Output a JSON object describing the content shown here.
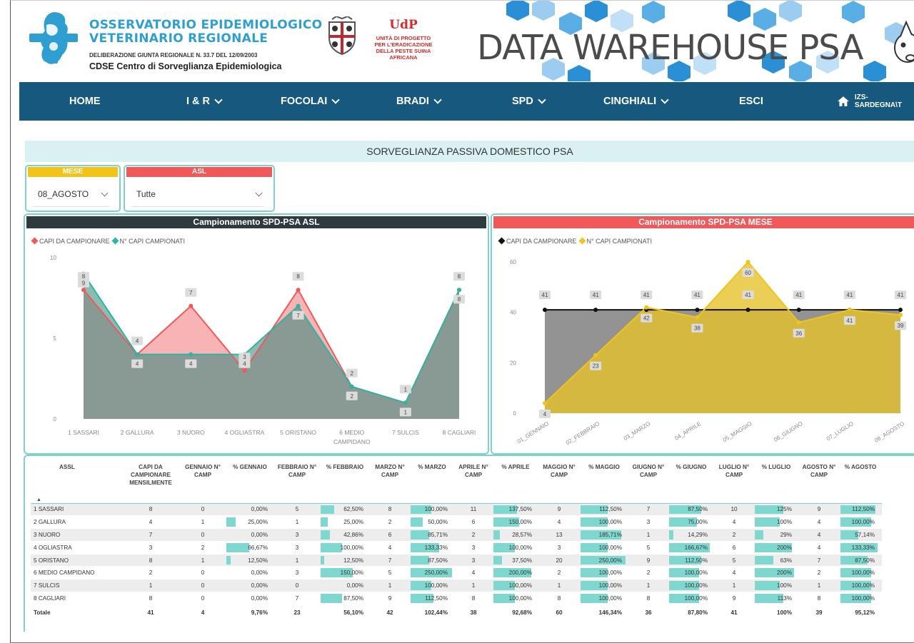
{
  "header": {
    "org_title_1": "OSSERVATORIO EPIDEMIOLOGICO",
    "org_title_2": "VETERINARIO REGIONALE",
    "org_sub": "DELIBERAZIONE GIUNTA REGIONALE N. 33.7 DEL 12/09/2003",
    "org_sub2": "CDSE Centro di Sorveglianza Epidemiologica",
    "udp_title": "UdP",
    "udp_sub": [
      "UNITÀ DI PROGETTO",
      "PER L'ERADICAZIONE",
      "DELLA PESTE SUINA",
      "AFRICANA"
    ],
    "banner_title": "DATA WAREHOUSE PSA",
    "colors": {
      "brand_blue": "#2f9fd2",
      "udp_red": "#d42a2a",
      "hex_blue": "#2b8fd6"
    }
  },
  "nav": {
    "items": [
      {
        "label": "HOME",
        "dropdown": false
      },
      {
        "label": "I & R",
        "dropdown": true
      },
      {
        "label": "FOCOLAI",
        "dropdown": true
      },
      {
        "label": "BRADI",
        "dropdown": true
      },
      {
        "label": "SPD",
        "dropdown": true
      },
      {
        "label": "CINGHIALI",
        "dropdown": true
      },
      {
        "label": "ESCI",
        "dropdown": false
      }
    ],
    "user": "IZS-SARDEGNA\\T",
    "user_icon": "home-icon",
    "background": "#17587e"
  },
  "section_title": "SORVEGLIANZA PASSIVA DOMESTICO PSA",
  "filters": {
    "mese": {
      "label": "MESE",
      "value": "08_AGOSTO",
      "color": "#f0c419"
    },
    "asl": {
      "label": "ASL",
      "value": "Tutte",
      "color": "#f0585a"
    }
  },
  "chart_data": [
    {
      "type": "area",
      "title": "Campionamento SPD-PSA ASL",
      "header_color": "#2f3a3e",
      "legend": [
        "CAPI DA CAMPIONARE",
        "N° CAPI CAMPIONATI"
      ],
      "categories": [
        "1 SASSARI",
        "2 GALLURA",
        "3 NUORO",
        "4 OGLIASTRA",
        "5 ORISTANO",
        "6 MEDIO CAMPIDANO",
        "7 SULCIS",
        "8 CAGLIARI"
      ],
      "series": [
        {
          "name": "CAPI DA CAMPIONARE",
          "values": [
            8,
            4,
            7,
            3,
            8,
            2,
            1,
            8
          ],
          "color": "#f0585a"
        },
        {
          "name": "N° CAPI CAMPIONATI",
          "values": [
            9,
            4,
            4,
            4,
            7,
            2,
            1,
            8
          ],
          "color": "#2bb5a5"
        }
      ],
      "yticks": [
        "0",
        "5",
        "10"
      ],
      "ylim": [
        0,
        10
      ],
      "grid": false
    },
    {
      "type": "area",
      "title": "Campionamento SPD-PSA MESE",
      "header_color": "#f0585a",
      "legend": [
        "CAPI DA CAMPIONARE",
        "N° CAPI CAMPIONATI"
      ],
      "categories": [
        "01_GENNAIO",
        "02_FEBBRAIO",
        "03_MARZO",
        "04_APRILE",
        "05_MAGGIO",
        "06_GIUGNO",
        "07_LUGLIO",
        "08_AGOSTO"
      ],
      "series": [
        {
          "name": "CAPI DA CAMPIONARE",
          "values": [
            41,
            41,
            41,
            41,
            41,
            41,
            41,
            41
          ],
          "color": "#111111"
        },
        {
          "name": "N° CAPI CAMPIONATI",
          "values": [
            4,
            23,
            42,
            38,
            60,
            36,
            41,
            39
          ],
          "color": "#f0c419"
        }
      ],
      "yticks": [
        "0",
        "20",
        "40",
        "60"
      ],
      "ylim": [
        0,
        60
      ],
      "grid": false
    }
  ],
  "table": {
    "headers": [
      "ASSL",
      "CAPI DA CAMPIONARE MENSILMENTE",
      "GENNAIO N° CAMP",
      "% GENNAIO",
      "FEBBRAIO N° CAMP",
      "% FEBBRAIO",
      "MARZO N° CAMP",
      "% MARZO",
      "APRILE N° CAMP",
      "% APRILE",
      "MAGGIO N° CAMP",
      "% MAGGIO",
      "GIUGNO N° CAMP",
      "% GIUGNO",
      "LUGLIO N° CAMP",
      "% LUGLIO",
      "AGOSTO N° CAMP",
      "% AGOSTO"
    ],
    "rows": [
      {
        "name": "1 SASSARI",
        "capi": "8",
        "cells": [
          [
            "0",
            "0,00%",
            0
          ],
          [
            "5",
            "62,50%",
            0.3
          ],
          [
            "8",
            "100,00%",
            0.5
          ],
          [
            "11",
            "137,50%",
            0.55
          ],
          [
            "9",
            "112,50%",
            0.6
          ],
          [
            "7",
            "87,50%",
            0.75
          ],
          [
            "10",
            "125%",
            0.7
          ],
          [
            "9",
            "112,50%",
            0.9
          ]
        ]
      },
      {
        "name": "2 GALLURA",
        "capi": "4",
        "cells": [
          [
            "1",
            "25,00%",
            0.2
          ],
          [
            "1",
            "25,00%",
            0.15
          ],
          [
            "2",
            "50,00%",
            0.3
          ],
          [
            "6",
            "150,00%",
            0.6
          ],
          [
            "4",
            "100,00%",
            0.6
          ],
          [
            "3",
            "75,00%",
            0.65
          ],
          [
            "4",
            "100%",
            0.6
          ],
          [
            "4",
            "100,00%",
            0.8
          ]
        ]
      },
      {
        "name": "3 NUORO",
        "capi": "7",
        "cells": [
          [
            "0",
            "0,00%",
            0
          ],
          [
            "3",
            "42,86%",
            0.2
          ],
          [
            "6",
            "85,71%",
            0.45
          ],
          [
            "2",
            "28,57%",
            0.15
          ],
          [
            "13",
            "185,71%",
            0.9
          ],
          [
            "1",
            "14,29%",
            0.1
          ],
          [
            "2",
            "29%",
            0.2
          ],
          [
            "4",
            "57,14%",
            0.45
          ]
        ]
      },
      {
        "name": "4 OGLIASTRA",
        "capi": "3",
        "cells": [
          [
            "2",
            "66,67%",
            0.5
          ],
          [
            "3",
            "100,00%",
            0.45
          ],
          [
            "4",
            "133,33%",
            0.7
          ],
          [
            "3",
            "100,00%",
            0.5
          ],
          [
            "3",
            "100,00%",
            0.6
          ],
          [
            "5",
            "166,67%",
            0.95
          ],
          [
            "6",
            "200%",
            0.9
          ],
          [
            "4",
            "133,33%",
            0.95
          ]
        ]
      },
      {
        "name": "5 ORISTANO",
        "capi": "8",
        "cells": [
          [
            "1",
            "12,50%",
            0.1
          ],
          [
            "1",
            "12,50%",
            0.08
          ],
          [
            "7",
            "87,50%",
            0.45
          ],
          [
            "3",
            "37,50%",
            0.2
          ],
          [
            "20",
            "250,00%",
            1.0
          ],
          [
            "9",
            "112,50%",
            0.75
          ],
          [
            "5",
            "63%",
            0.45
          ],
          [
            "7",
            "87,50%",
            0.7
          ]
        ]
      },
      {
        "name": "6 MEDIO CAMPIDANO",
        "capi": "2",
        "cells": [
          [
            "0",
            "0,00%",
            0
          ],
          [
            "3",
            "150,00%",
            0.7
          ],
          [
            "5",
            "250,00%",
            1.0
          ],
          [
            "4",
            "200,00%",
            0.9
          ],
          [
            "2",
            "100,00%",
            0.6
          ],
          [
            "2",
            "100,00%",
            0.7
          ],
          [
            "4",
            "200%",
            0.95
          ],
          [
            "2",
            "100,00%",
            0.8
          ]
        ]
      },
      {
        "name": "7 SULCIS",
        "capi": "1",
        "cells": [
          [
            "0",
            "0,00%",
            0
          ],
          [
            "0",
            "0,00%",
            0
          ],
          [
            "1",
            "100,00%",
            0.5
          ],
          [
            "1",
            "100,00%",
            0.5
          ],
          [
            "1",
            "100,00%",
            0.6
          ],
          [
            "1",
            "100,00%",
            0.7
          ],
          [
            "1",
            "100%",
            0.6
          ],
          [
            "1",
            "100,00%",
            0.8
          ]
        ]
      },
      {
        "name": "8 CAGLIARI",
        "capi": "8",
        "cells": [
          [
            "0",
            "0,00%",
            0
          ],
          [
            "7",
            "87,50%",
            0.45
          ],
          [
            "9",
            "112,50%",
            0.55
          ],
          [
            "8",
            "100,00%",
            0.5
          ],
          [
            "8",
            "100,00%",
            0.6
          ],
          [
            "8",
            "100,00%",
            0.7
          ],
          [
            "9",
            "113%",
            0.7
          ],
          [
            "8",
            "100,00%",
            0.8
          ]
        ]
      }
    ],
    "total": {
      "name": "Totale",
      "capi": "41",
      "cells": [
        [
          "4",
          "9,76%"
        ],
        [
          "23",
          "56,10%"
        ],
        [
          "42",
          "102,44%"
        ],
        [
          "38",
          "92,68%"
        ],
        [
          "60",
          "146,34%"
        ],
        [
          "36",
          "87,80%"
        ],
        [
          "41",
          "100%"
        ],
        [
          "39",
          "95,12%"
        ]
      ]
    },
    "bar_color": "#7fd8d0"
  }
}
